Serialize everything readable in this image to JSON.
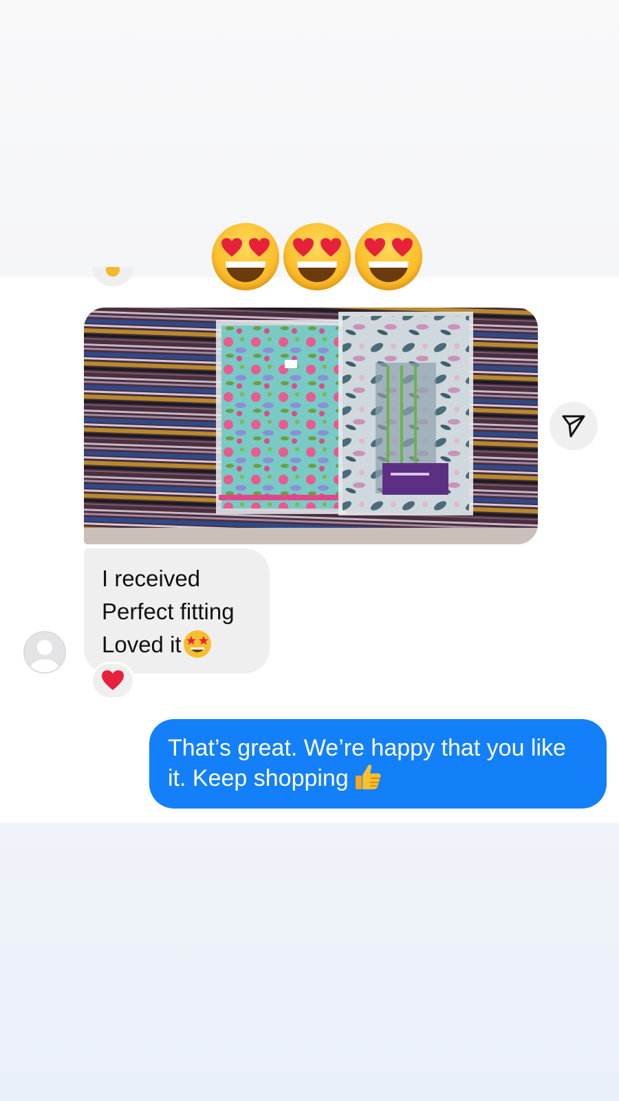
{
  "reaction_emoji": {
    "icon": "heart-eyes-emoji",
    "count_shown": 3
  },
  "conversation": {
    "photo_message": {
      "icon": "photo-attachment",
      "share_icon": "share-send-icon"
    },
    "incoming_message": {
      "lines": [
        "I received",
        "Perfect fitting",
        "Loved it"
      ],
      "trailing_emoji": "star-struck-emoji",
      "reaction": "red-heart"
    },
    "outgoing_message": {
      "line1": "That’s great. We’re happy that you like",
      "line2": "it. Keep shopping",
      "trailing_emoji": "thumbs-up-emoji"
    }
  },
  "colors": {
    "outgoing_bubble": "#1380f9",
    "incoming_bubble": "#efefef",
    "text_dark": "#111111"
  }
}
